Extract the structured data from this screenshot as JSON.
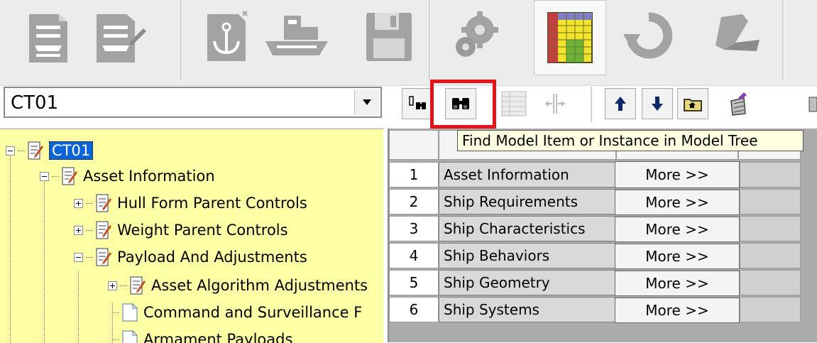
{
  "combo": {
    "value": "CT01"
  },
  "tooltip": {
    "text": "Find Model Item or Instance in Model Tree"
  },
  "top_toolbar": {
    "icons": [
      "ship-profile-icon",
      "ship-profile-edit-icon",
      "anchor-document-icon",
      "ship-model-icon",
      "save-disk-icon",
      "gear-settings-icon",
      "spreadsheet-grid-icon",
      "refresh-icon",
      "comment-icon"
    ]
  },
  "tree": {
    "nodes": [
      {
        "label": "CT01",
        "selected": true
      },
      {
        "label": "Asset Information"
      },
      {
        "label": "Hull Form Parent Controls"
      },
      {
        "label": "Weight Parent Controls"
      },
      {
        "label": "Payload And Adjustments"
      },
      {
        "label": "Asset Algorithm Adjustments"
      },
      {
        "label": "Command and Surveillance F"
      },
      {
        "label": "Armament Payloads"
      }
    ]
  },
  "grid": {
    "rows": [
      {
        "num": "1",
        "name": "Asset Information",
        "action": "More >>"
      },
      {
        "num": "2",
        "name": "Ship Requirements",
        "action": "More >>"
      },
      {
        "num": "3",
        "name": "Ship Characteristics",
        "action": "More >>"
      },
      {
        "num": "4",
        "name": "Ship Behaviors",
        "action": "More >>"
      },
      {
        "num": "5",
        "name": "Ship Geometry",
        "action": "More >>"
      },
      {
        "num": "6",
        "name": "Ship Systems",
        "action": "More >>"
      }
    ]
  },
  "colors": {
    "tree_bg": "#ffffa6",
    "highlight": "#e3151a",
    "tooltip_bg": "#ffffe1",
    "selection": "#0a64d8"
  }
}
